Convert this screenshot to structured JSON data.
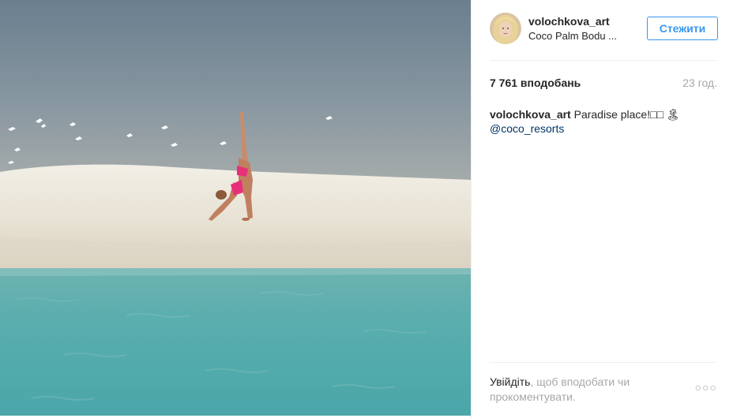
{
  "post": {
    "author": {
      "username": "volochkova_art",
      "location": "Coco Palm Bodu ..."
    },
    "follow_label": "Стежити",
    "likes": "7 761 вподобань",
    "time_ago": "23 год.",
    "caption": {
      "author": "volochkova_art",
      "text": "Paradise place!",
      "emoji": "□□ 🏝",
      "mention": "@coco_resorts"
    },
    "login_prompt": {
      "link": "Увійдіть",
      "text": ", щоб вподобати чи прокоментувати."
    },
    "more_icon": "ellipsis-icon"
  },
  "colors": {
    "accent": "#3897f0",
    "muted": "#a5a7aa",
    "text": "#262626",
    "mention": "#003569",
    "divider": "#efefef"
  }
}
